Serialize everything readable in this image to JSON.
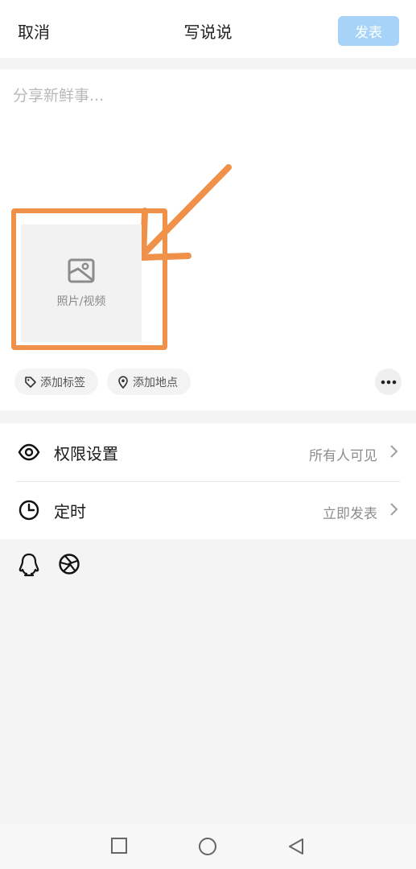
{
  "header": {
    "cancel_label": "取消",
    "title": "写说说",
    "publish_label": "发表"
  },
  "compose": {
    "placeholder": "分享新鲜事...",
    "photo_tile_label": "照片/视频",
    "tag_chip_label": "添加标签",
    "location_chip_label": "添加地点"
  },
  "settings": {
    "permission": {
      "label": "权限设置",
      "value": "所有人可见"
    },
    "schedule": {
      "label": "定时",
      "value": "立即发表"
    }
  },
  "share_icons": [
    "qq-icon",
    "camera-aperture-icon"
  ],
  "colors": {
    "accent_publish": "#a6d3f7",
    "highlight": "#f0914a"
  }
}
